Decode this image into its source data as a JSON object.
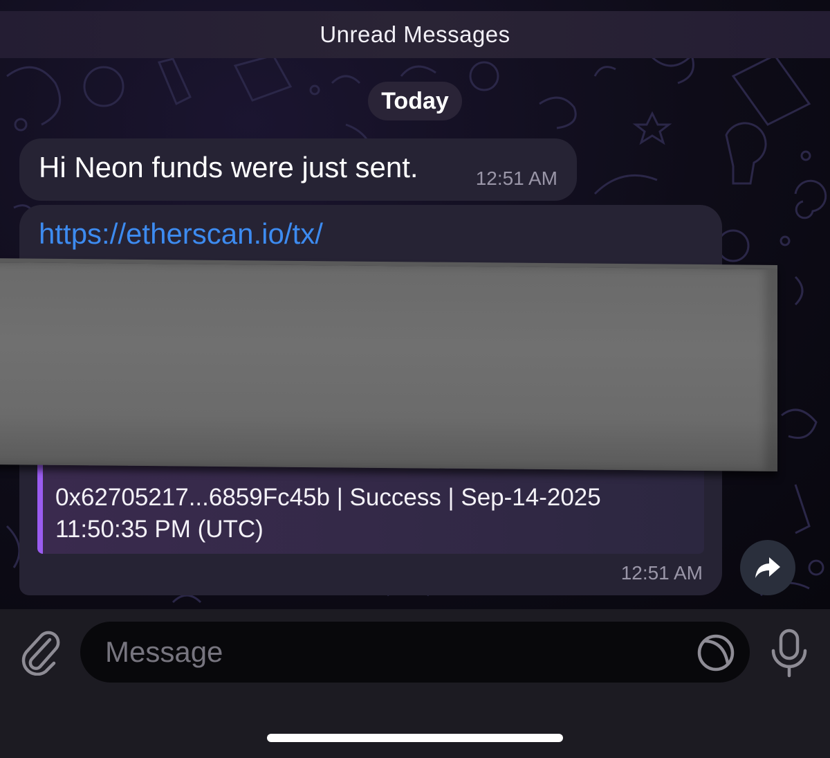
{
  "chat": {
    "unread_label": "Unread Messages",
    "date_label": "Today",
    "messages": [
      {
        "text": "Hi Neon funds were just sent.",
        "time": "12:51 AM"
      },
      {
        "link": "https://etherscan.io/tx/",
        "preview_description": "0x62705217...6859Fc45b | Success | Sep-14-2025 11:50:35 PM (UTC)",
        "time": "12:51 AM",
        "accent_color": "#9a5cf0"
      }
    ]
  },
  "composer": {
    "placeholder": "Message",
    "icons": [
      "paperclip-icon",
      "sticker-icon",
      "microphone-icon"
    ]
  },
  "colors": {
    "link": "#3d8bf0",
    "bubble": "#262334",
    "background": "#0b0a12"
  }
}
